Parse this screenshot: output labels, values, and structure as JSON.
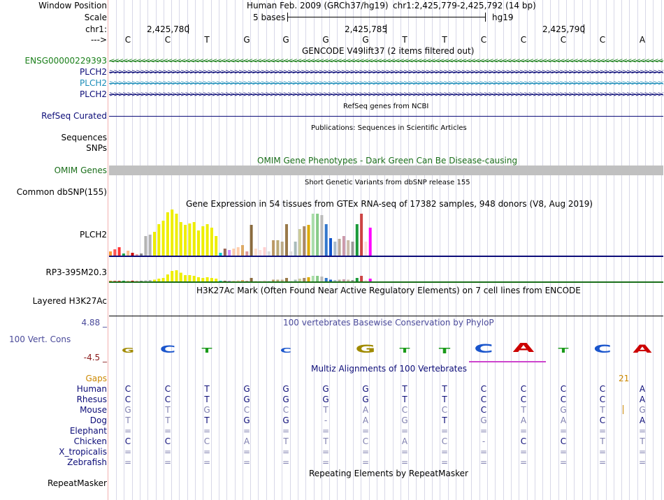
{
  "header": {
    "window_position_label": "Window Position",
    "scale_label": "Scale",
    "chr_label": "chr1:",
    "arrow_label": "--->",
    "assembly_text": "Human Feb. 2009 (GRCh37/hg19)",
    "position_text": "chr1:2,425,779-2,425,792 (14 bp)",
    "scale_text": "5 bases",
    "db_text": "hg19",
    "ticks": [
      "2,425,780",
      "2,425,785",
      "2,425,790"
    ]
  },
  "sequence": [
    "C",
    "C",
    "T",
    "G",
    "G",
    "G",
    "G",
    "T",
    "T",
    "C",
    "C",
    "C",
    "C",
    "A"
  ],
  "tracks": {
    "gencode": {
      "title": "GENCODE V49lift37 (2 items filtered out)",
      "genes": [
        {
          "label": "ENSG00000229393",
          "color": "#1a7f1a",
          "direction": "reverse"
        },
        {
          "label": "PLCH2",
          "color": "#0c0c78",
          "direction": "forward"
        },
        {
          "label": "PLCH2",
          "color": "#1a8cb8",
          "direction": "forward"
        },
        {
          "label": "PLCH2",
          "color": "#0c0c78",
          "direction": "forward"
        }
      ]
    },
    "refseq": {
      "label": "RefSeq Curated",
      "title": "RefSeq genes from NCBI",
      "color": "#0c0c78"
    },
    "publications": {
      "title": "Publications: Sequences in Scientific Articles",
      "labels": [
        "Sequences",
        "SNPs"
      ]
    },
    "omim": {
      "title": "OMIM Gene Phenotypes - Dark Green Can Be Disease-causing",
      "label": "OMIM Genes",
      "color": "#1a6e1a",
      "bar_color": "#c0c0c0"
    },
    "dbsnp": {
      "label": "Common dbSNP(155)",
      "title": "Short Genetic Variants from dbSNP release 155"
    },
    "gtex": {
      "title": "Gene Expression in 54 tissues from GTEx RNA-seq of 17382 samples, 948 donors (V8, Aug 2019)",
      "genes": [
        {
          "label": "PLCH2",
          "underline_color": "#0c0c78"
        },
        {
          "label": "RP3-395M20.3",
          "underline_color": "#1a6e1a"
        }
      ],
      "values_1": [
        6,
        9,
        12,
        3,
        7,
        4,
        2,
        3,
        28,
        30,
        34,
        45,
        50,
        62,
        66,
        60,
        48,
        44,
        46,
        48,
        36,
        42,
        45,
        40,
        28,
        4,
        10,
        8,
        10,
        12,
        15,
        6,
        44,
        10,
        8,
        12,
        6,
        22,
        22,
        20,
        45,
        6,
        20,
        38,
        42,
        44,
        60,
        60,
        58,
        45,
        25,
        20,
        24,
        28,
        22,
        20,
        45,
        60,
        20,
        40,
        45,
        40,
        48,
        60,
        58,
        50,
        56,
        45,
        44,
        40,
        36,
        30,
        42,
        44,
        20,
        24,
        30,
        28,
        26,
        30,
        42,
        42,
        60,
        60,
        55,
        34,
        20,
        12,
        28,
        24,
        45,
        28,
        48,
        20
      ],
      "values_2": [
        1,
        1,
        2,
        1,
        2,
        1,
        1,
        1,
        3,
        4,
        5,
        8,
        10,
        20,
        30,
        32,
        25,
        18,
        18,
        16,
        12,
        10,
        12,
        10,
        8,
        1,
        2,
        2,
        2,
        3,
        4,
        1,
        10,
        2,
        2,
        3,
        1,
        5,
        5,
        5,
        10,
        1,
        5,
        8,
        10,
        12,
        16,
        16,
        14,
        10,
        5,
        4,
        5,
        6,
        5,
        4,
        10,
        16,
        4,
        8,
        10,
        8,
        10,
        14,
        13,
        10,
        12,
        10,
        10,
        8,
        8,
        6,
        9,
        10,
        4,
        5,
        6,
        6,
        5,
        6,
        9,
        9,
        14,
        14,
        12,
        8,
        4,
        3,
        6,
        5,
        10,
        6,
        10,
        4
      ],
      "colors": [
        "#ff9933",
        "#ff5555",
        "#ff3333",
        "#1fa34a",
        "#ffbb88",
        "#cc0000",
        "#f0a0a0",
        "#888888",
        "#b3b3b3",
        "#b3b3b3",
        "#eeee00",
        "#eeee00",
        "#eeee00",
        "#eeee00",
        "#eeee00",
        "#eeee00",
        "#eeee00",
        "#eeee00",
        "#eeee00",
        "#eeee00",
        "#eeee00",
        "#eeee00",
        "#eeee00",
        "#eeee00",
        "#eeee00",
        "#00cccc",
        "#996655",
        "#cc88ff",
        "#ffccaa",
        "#ffccaa",
        "#ddaa66",
        "#dd9999",
        "#8a6b3f",
        "#ffddcc",
        "#ffe0e0",
        "#ffd0d0",
        "#dddddd",
        "#bb9966",
        "#bbaa77",
        "#bbaa88",
        "#9a7a4a",
        "#dddddd",
        "#aabbbb",
        "#cccc99",
        "#aa8866",
        "#ddaa00",
        "#aaddaa",
        "#88cc88",
        "#bbbbbb",
        "#3377cc",
        "#1155cc",
        "#aabbcc",
        "#bbaa99",
        "#cc99aa",
        "#ccbbaa",
        "#999999",
        "#1a9a3a",
        "#cc4444",
        "#ffdddd",
        "#ff00ff"
      ]
    },
    "h3k27ac": {
      "title": "H3K27Ac Mark (Often Found Near Active Regulatory Elements) on 7 cell lines from ENCODE",
      "label": "Layered H3K27Ac"
    },
    "phylop": {
      "title": "100 vertebrates Basewise Conservation by PhyloP",
      "label": "100 Vert. Cons",
      "max_label": "4.88 _",
      "min_label": "-4.5 _",
      "color": "#4a4a9a",
      "min_color": "#8a1a1a"
    },
    "multiz": {
      "title": "Multiz Alignments of 100 Vertebrates",
      "gaps_label": "Gaps",
      "gaps_value": "21",
      "gaps_color": "#cc8800",
      "species": [
        {
          "name": "Human",
          "bases": [
            "C",
            "C",
            "T",
            "G",
            "G",
            "G",
            "G",
            "T",
            "T",
            "C",
            "C",
            "C",
            "C",
            "A"
          ]
        },
        {
          "name": "Rhesus",
          "bases": [
            "C",
            "C",
            "T",
            "G",
            "G",
            "G",
            "G",
            "T",
            "T",
            "C",
            "C",
            "C",
            "C",
            "A"
          ]
        },
        {
          "name": "Mouse",
          "bases": [
            "G",
            "T",
            "G",
            "C",
            "C",
            "T",
            "A",
            "C",
            "C",
            "C",
            "T",
            "G",
            "T",
            "G"
          ]
        },
        {
          "name": "Dog",
          "bases": [
            "T",
            "T",
            "T",
            "G",
            "G",
            "-",
            "A",
            "G",
            "T",
            "G",
            "A",
            "A",
            "C",
            "A"
          ]
        },
        {
          "name": "Elephant",
          "bases": [
            "=",
            "=",
            "=",
            "=",
            "=",
            "=",
            "=",
            "=",
            "=",
            "=",
            "=",
            "=",
            "=",
            "="
          ]
        },
        {
          "name": "Chicken",
          "bases": [
            "C",
            "C",
            "C",
            "A",
            "T",
            "T",
            "C",
            "A",
            "C",
            "-",
            "C",
            "C",
            "T",
            "T"
          ]
        },
        {
          "name": "X_tropicalis",
          "bases": [
            "=",
            "=",
            "=",
            "=",
            "=",
            "=",
            "=",
            "=",
            "=",
            "=",
            "=",
            "=",
            "=",
            "="
          ]
        },
        {
          "name": "Zebrafish",
          "bases": [
            "=",
            "=",
            "=",
            "=",
            "=",
            "=",
            "=",
            "=",
            "=",
            "=",
            "=",
            "=",
            "=",
            "="
          ]
        }
      ]
    },
    "repeatmasker": {
      "label": "RepeatMasker",
      "title": "Repeating Elements by RepeatMasker"
    }
  }
}
